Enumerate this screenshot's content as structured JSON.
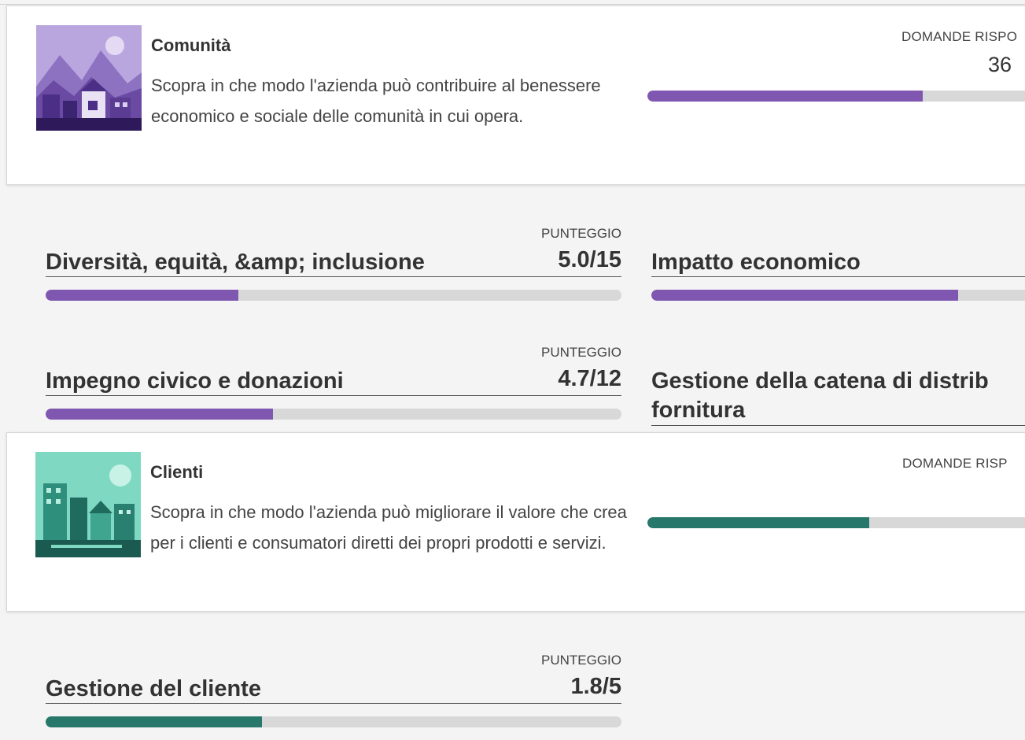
{
  "communities": {
    "title": "Comunità",
    "description": "Scopra in che modo l'azienda può contribuire al benessere economico e sociale delle comunità in cui opera.",
    "answered_label": "DOMANDE RISPO",
    "answered_value": "36",
    "progress": 0.75,
    "color": "#7f57b0",
    "image_icon": "village-illustration",
    "metrics": [
      {
        "label": "PUNTEGGIO",
        "title": "Diversità, equità, &amp; inclusione",
        "score": "5.0/15",
        "progress": 0.335
      },
      {
        "label": "",
        "title": "Impatto economico",
        "score": "",
        "progress": 0.845
      },
      {
        "label": "PUNTEGGIO",
        "title": "Impegno civico e donazioni",
        "score": "4.7/12",
        "progress": 0.395
      },
      {
        "label": "",
        "title_line1": "Gestione della catena di distrib",
        "title_line2": "fornitura",
        "score": ""
      }
    ]
  },
  "customers": {
    "title": "Clienti",
    "description": "Scopra in che modo l'azienda può migliorare il valore che crea per i clienti e consumatori diretti dei propri prodotti e servizi.",
    "answered_label": "DOMANDE RISP",
    "progress": 0.6,
    "color": "#27776a",
    "image_icon": "city-illustration",
    "metrics": [
      {
        "label": "PUNTEGGIO",
        "title": "Gestione del cliente",
        "score": "1.8/5",
        "progress": 0.375
      }
    ]
  },
  "colors": {
    "track": "#d8d8d8",
    "purple": "#7f57b0",
    "teal": "#27776a"
  }
}
